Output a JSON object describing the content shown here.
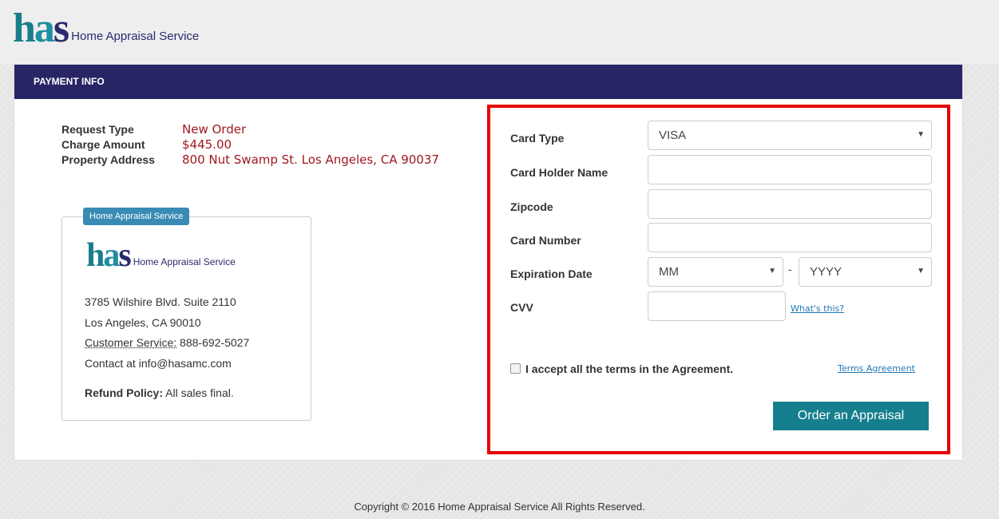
{
  "header": {
    "logo_text": "has",
    "logo_subtitle": "Home Appraisal Service"
  },
  "panel": {
    "title": "PAYMENT INFO"
  },
  "request_info": {
    "request_type_label": "Request Type",
    "request_type_value": "New Order",
    "charge_amount_label": "Charge Amount",
    "charge_amount_value": "$445.00",
    "property_address_label": "Property Address",
    "property_address_value": "800 Nut Swamp St. Los Angeles, CA 90037"
  },
  "company_card": {
    "badge": "Home Appraisal Service",
    "logo_text": "has",
    "logo_subtitle": "Home Appraisal Service",
    "address_line1": "3785 Wilshire Blvd. Suite 2110",
    "address_line2": "Los Angeles, CA 90010",
    "customer_service_label": "Customer Service:",
    "customer_service_phone": "888-692-5027",
    "contact": "Contact at info@hasamc.com",
    "refund_label": "Refund Policy:",
    "refund_value": "All sales final."
  },
  "payment_form": {
    "card_type_label": "Card Type",
    "card_type_value": "VISA",
    "card_holder_label": "Card Holder Name",
    "card_holder_value": "",
    "zipcode_label": "Zipcode",
    "zipcode_value": "",
    "card_number_label": "Card Number",
    "card_number_value": "",
    "expiration_label": "Expiration Date",
    "exp_month_value": "MM",
    "exp_separator": "-",
    "exp_year_value": "YYYY",
    "cvv_label": "CVV",
    "cvv_value": "",
    "whats_this_link": "What's this?",
    "accept_terms_label": "I accept all the terms in the Agreement.",
    "accept_terms_checked": false,
    "terms_link": "Terms Agreement",
    "order_button": "Order an Appraisal"
  },
  "footer": {
    "copyright": "Copyright © 2016 Home Appraisal Service All Rights Reserved."
  },
  "colors": {
    "header_bar": "#282566",
    "accent_teal": "#167f8e",
    "value_red": "#a0181e",
    "highlight_border": "#e60000",
    "badge_blue": "#3a8bb3"
  }
}
